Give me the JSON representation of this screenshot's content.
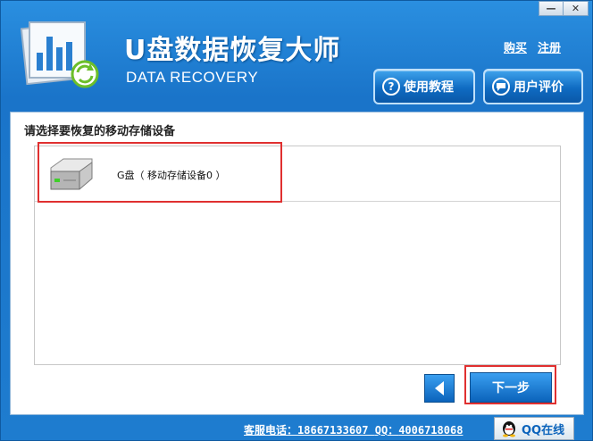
{
  "window": {
    "controls": {
      "minimize": "—",
      "close": "✕"
    }
  },
  "header": {
    "title_cn": "U盘数据恢复大师",
    "title_en": "DATA RECOVERY",
    "links": {
      "buy": "购买",
      "register": "注册"
    },
    "buttons": {
      "tutorial": {
        "icon": "question-icon",
        "label": "使用教程",
        "glyph": "?"
      },
      "review": {
        "icon": "chat-icon",
        "label": "用户评价"
      }
    }
  },
  "main": {
    "prompt": "请选择要恢复的移动存储设备",
    "devices": [
      {
        "icon": "hard-drive-icon",
        "label": "G盘（ 移动存储设备0 ）"
      }
    ]
  },
  "nav": {
    "back_icon": "arrow-left-icon",
    "next_label": "下一步"
  },
  "footer": {
    "phone_label": "客服电话：",
    "phone": "18667133607",
    "qq_label": "QQ：",
    "qq": "4006718068",
    "qq_button": "QQ在线"
  },
  "colors": {
    "accent": "#1a74c9",
    "highlight": "#e03030"
  }
}
